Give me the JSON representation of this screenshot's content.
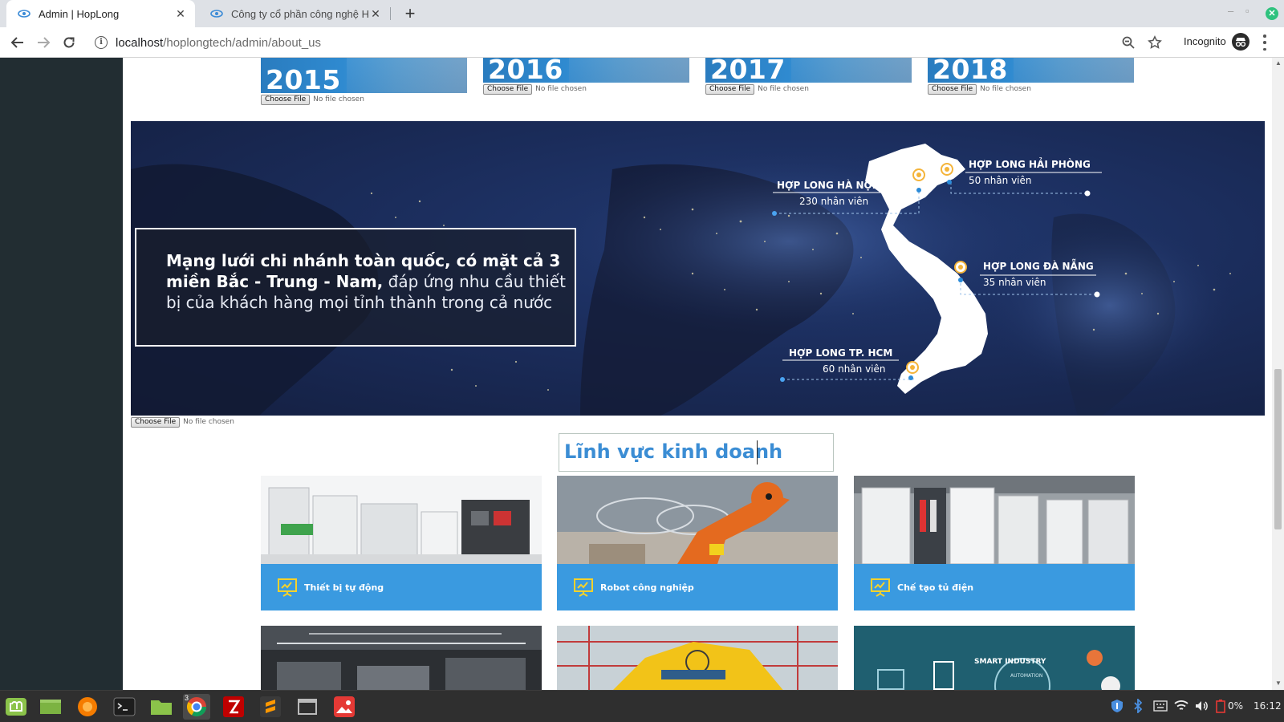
{
  "browser": {
    "tabs": [
      {
        "title": "Admin | HopLong",
        "active": true
      },
      {
        "title": "Công ty cổ phần công nghệ Hợp",
        "active": false
      }
    ],
    "url_host": "localhost",
    "url_path": "/hoplongtech/admin/about_us",
    "incognito_label": "Incognito",
    "icons": [
      "back-arrow-icon",
      "forward-arrow-icon",
      "reload-icon",
      "info-icon",
      "zoom-icon",
      "bookmark-star-icon",
      "incognito-icon",
      "menu-dots-icon"
    ]
  },
  "timeline": {
    "years": [
      "2015",
      "2016",
      "2017",
      "2018"
    ],
    "choose_file_label": "Choose File",
    "no_file_label": "No file chosen"
  },
  "network_banner": {
    "headline_bold": "Mạng lưới chi nhánh toàn quốc, có mặt cả 3 miền Bắc - Trung - Nam,",
    "headline_rest": "đáp ứng nhu cầu thiết bị của khách hàng mọi tỉnh thành trong cả nước",
    "branches": [
      {
        "name": "HỢP LONG HÀ NỘI",
        "staff": "230 nhân viên"
      },
      {
        "name": "HỢP LONG HẢI PHÒNG",
        "staff": "50 nhân viên"
      },
      {
        "name": "HỢP LONG ĐÀ NẴNG",
        "staff": "35 nhân viên"
      },
      {
        "name": "HỢP LONG TP. HCM",
        "staff": "60 nhân viên"
      }
    ],
    "choose_file_label": "Choose File",
    "no_file_label": "No file chosen"
  },
  "business": {
    "title": "Lĩnh vực kinh doanh",
    "cards": [
      {
        "label": "Thiết bị tự động",
        "icon": "presentation-chart-icon"
      },
      {
        "label": "Robot công nghiệp",
        "icon": "presentation-chart-icon"
      },
      {
        "label": "Chế tạo tủ điện",
        "icon": "presentation-chart-icon"
      }
    ],
    "partial_cards": [
      "warehouse-image",
      "yellow-robot-image",
      "smart-industry-image"
    ],
    "smart_industry_text": "SMART INDUSTRY",
    "automation_text": "AUTOMATION"
  },
  "taskbar": {
    "apps": [
      "mint-menu-icon",
      "show-desktop-icon",
      "firefox-icon",
      "terminal-icon",
      "files-icon",
      "chrome-icon",
      "filezilla-icon",
      "sublime-text-icon",
      "window-icon",
      "image-viewer-icon"
    ],
    "chrome_badge": "3",
    "battery": "0%",
    "time": "16:12"
  },
  "colors": {
    "accent_blue": "#3a9ae0",
    "title_blue": "#3b8dd4",
    "sidebar": "#222d32"
  }
}
